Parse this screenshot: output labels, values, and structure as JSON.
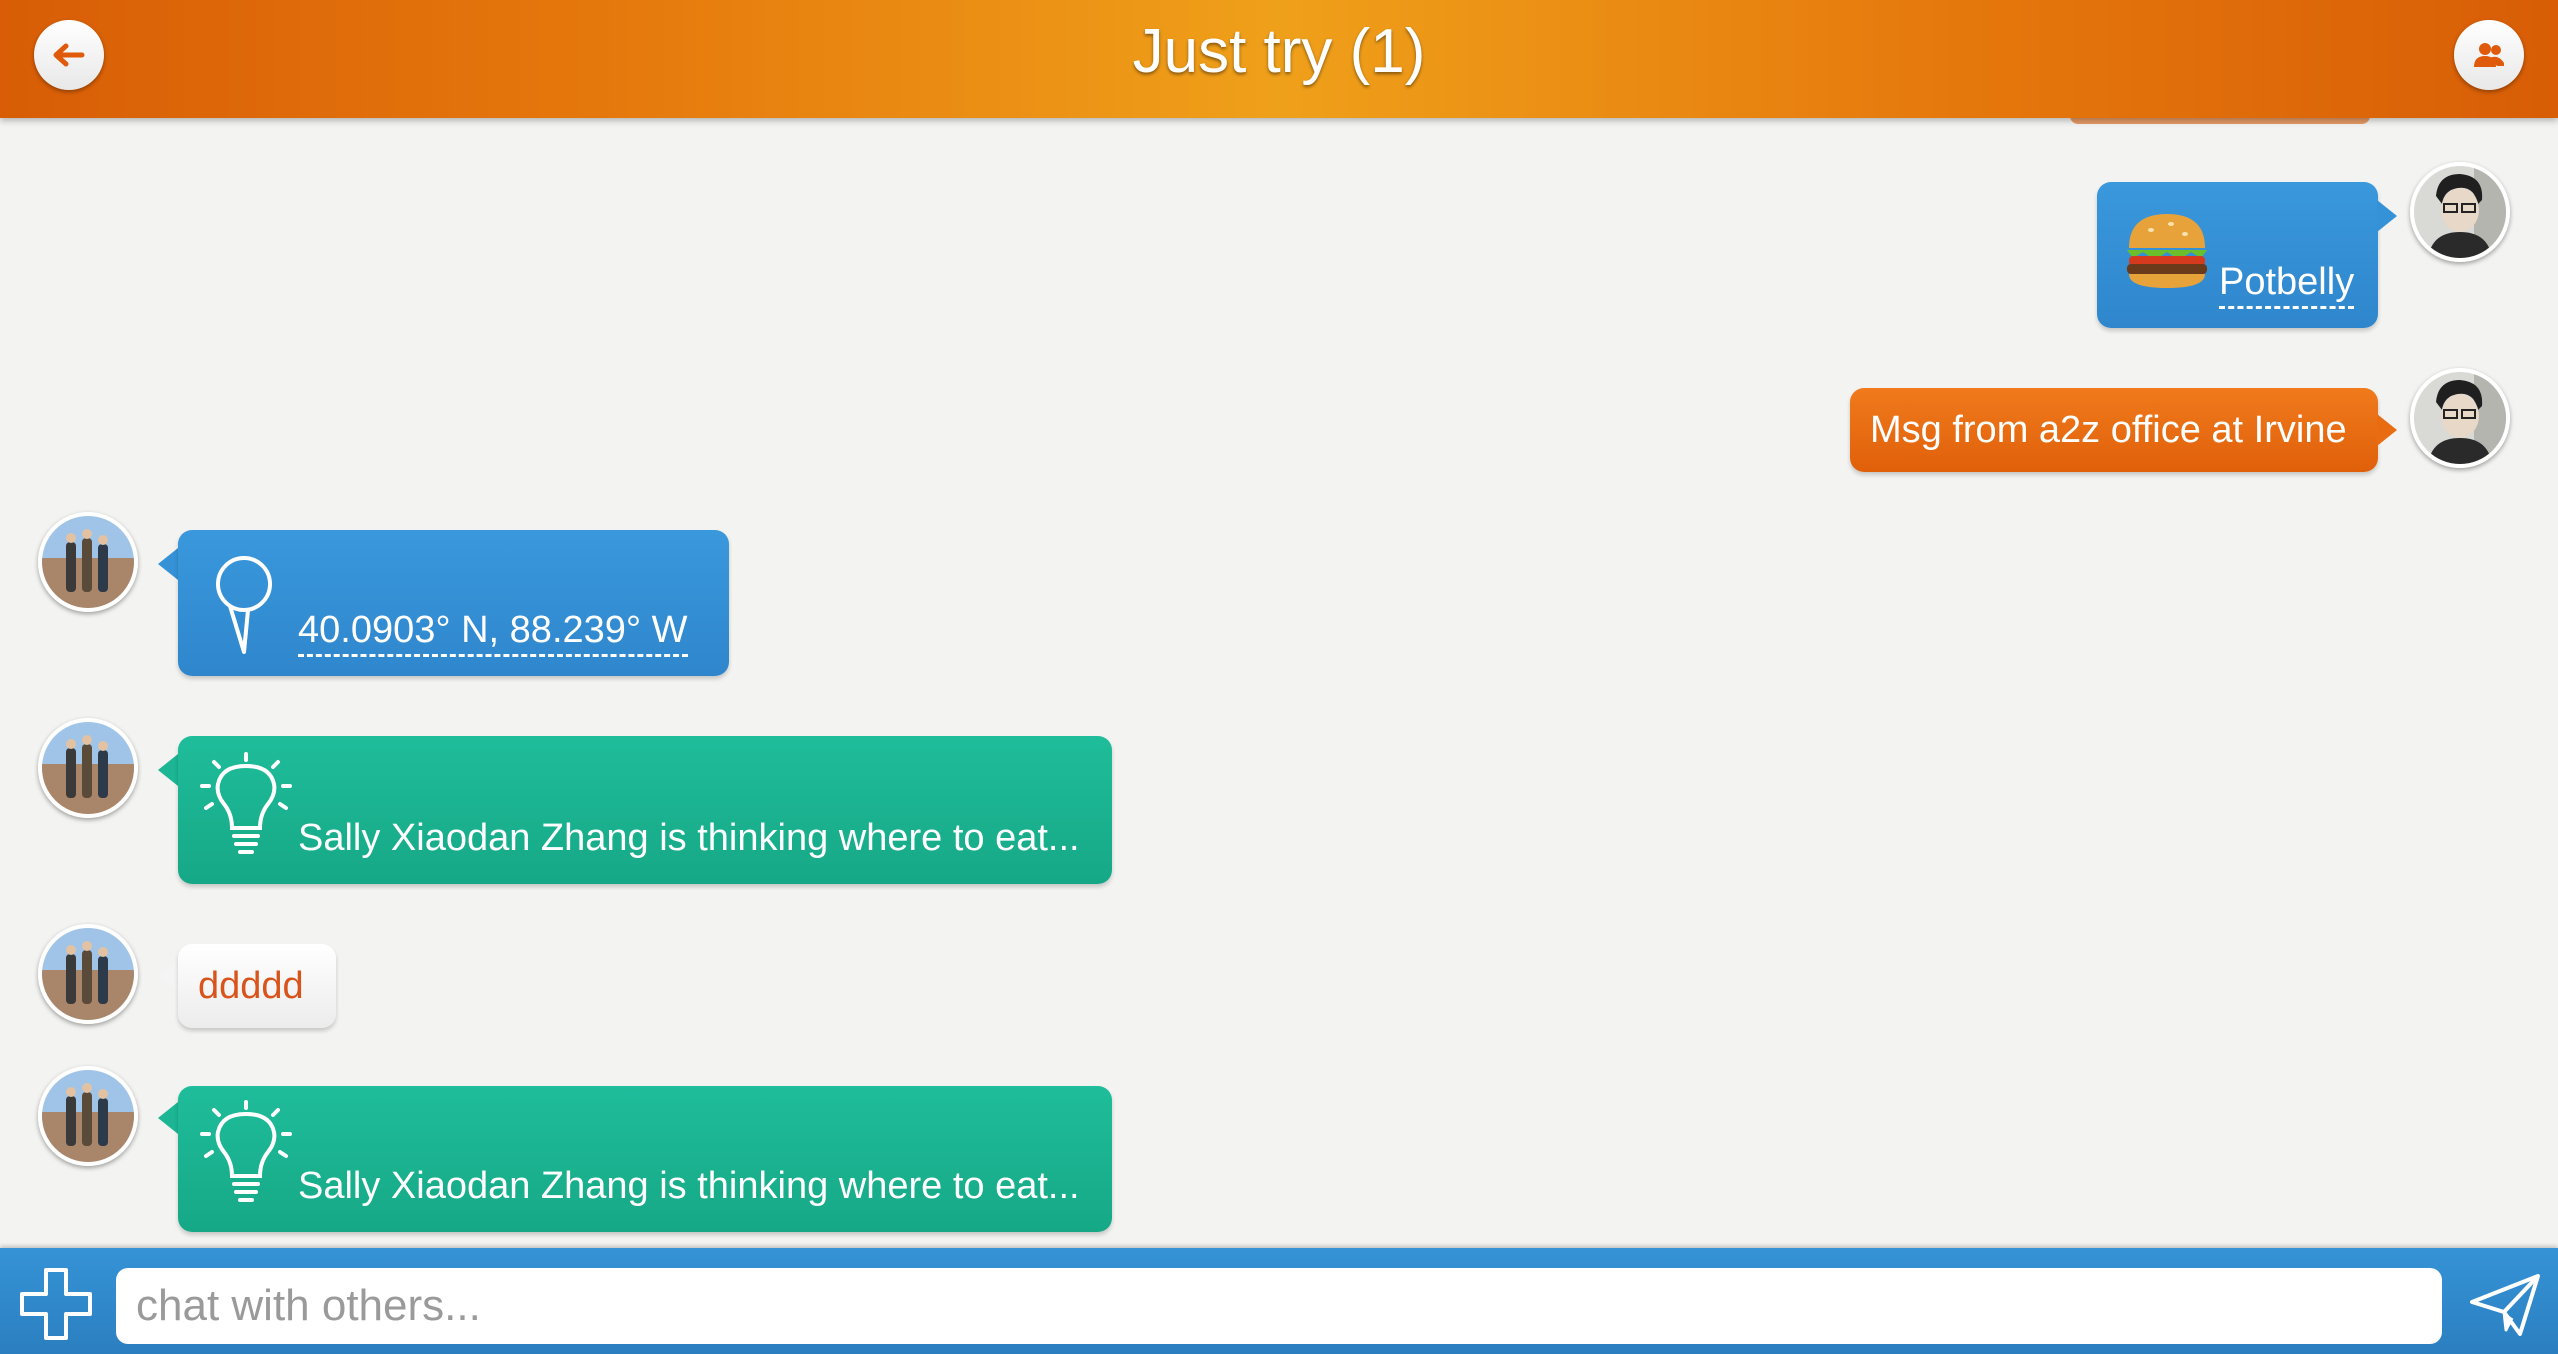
{
  "header": {
    "title": "Just try (1)",
    "back_icon": "back-arrow-icon",
    "members_icon": "group-icon",
    "brand_color": "#e67a0d"
  },
  "messages": [
    {
      "side": "right",
      "type": "restaurant",
      "icon": "burger-icon",
      "text": "Potbelly",
      "color": "#3a98dc"
    },
    {
      "side": "right",
      "type": "text",
      "text": "Msg from a2z office at Irvine",
      "color": "#f07a1c"
    },
    {
      "side": "left",
      "type": "location",
      "icon": "map-pin-icon",
      "text": "40.0903° N, 88.239° W",
      "color": "#3a98dc"
    },
    {
      "side": "left",
      "type": "status",
      "icon": "lightbulb-icon",
      "text": "Sally Xiaodan Zhang is thinking where to eat...",
      "color": "#1fbd9b"
    },
    {
      "side": "left",
      "type": "text",
      "text": "ddddd",
      "color": "#ffffff"
    },
    {
      "side": "left",
      "type": "status",
      "icon": "lightbulb-icon",
      "text": "Sally Xiaodan Zhang is thinking where to eat...",
      "color": "#1fbd9b"
    }
  ],
  "composer": {
    "placeholder": "chat with others...",
    "value": "",
    "attach_icon": "plus-icon",
    "send_icon": "send-icon",
    "bar_color": "#3593d6"
  }
}
